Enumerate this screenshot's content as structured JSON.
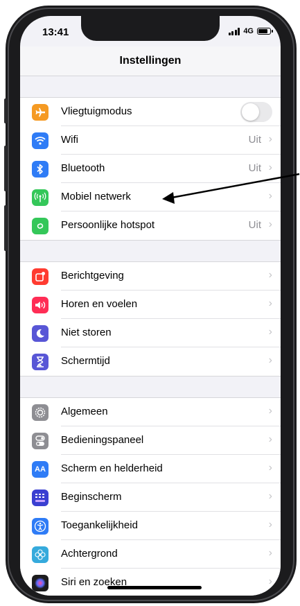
{
  "status": {
    "time": "13:41",
    "network": "4G"
  },
  "nav": {
    "title": "Instellingen"
  },
  "groups": [
    {
      "items": [
        {
          "label": "Vliegtuigmodus",
          "icon": "airplane-icon",
          "color": "#f59a23",
          "toggle": false
        },
        {
          "label": "Wifi",
          "icon": "wifi-icon",
          "color": "#2f7cf6",
          "value": "Uit"
        },
        {
          "label": "Bluetooth",
          "icon": "bluetooth-icon",
          "color": "#2f7cf6",
          "value": "Uit"
        },
        {
          "label": "Mobiel netwerk",
          "icon": "antenna-icon",
          "color": "#34c759"
        },
        {
          "label": "Persoonlijke hotspot",
          "icon": "hotspot-icon",
          "color": "#34c759",
          "value": "Uit"
        }
      ]
    },
    {
      "items": [
        {
          "label": "Berichtgeving",
          "icon": "notifications-icon",
          "color": "#ff3b30"
        },
        {
          "label": "Horen en voelen",
          "icon": "speaker-icon",
          "color": "#ff2d55"
        },
        {
          "label": "Niet storen",
          "icon": "moon-icon",
          "color": "#5856d6"
        },
        {
          "label": "Schermtijd",
          "icon": "hourglass-icon",
          "color": "#5856d6"
        }
      ]
    },
    {
      "items": [
        {
          "label": "Algemeen",
          "icon": "gear-icon",
          "color": "#8e8e93"
        },
        {
          "label": "Bedieningspaneel",
          "icon": "switches-icon",
          "color": "#8e8e93"
        },
        {
          "label": "Scherm en helderheid",
          "icon": "text-size-icon",
          "color": "#2f7cf6"
        },
        {
          "label": "Beginscherm",
          "icon": "home-grid-icon",
          "color": "#3a3fd1"
        },
        {
          "label": "Toegankelijkheid",
          "icon": "accessibility-icon",
          "color": "#2f7cf6"
        },
        {
          "label": "Achtergrond",
          "icon": "flower-icon",
          "color": "#35aadc"
        },
        {
          "label": "Siri en zoeken",
          "icon": "siri-icon",
          "color": "#1c1c1e"
        }
      ]
    }
  ]
}
